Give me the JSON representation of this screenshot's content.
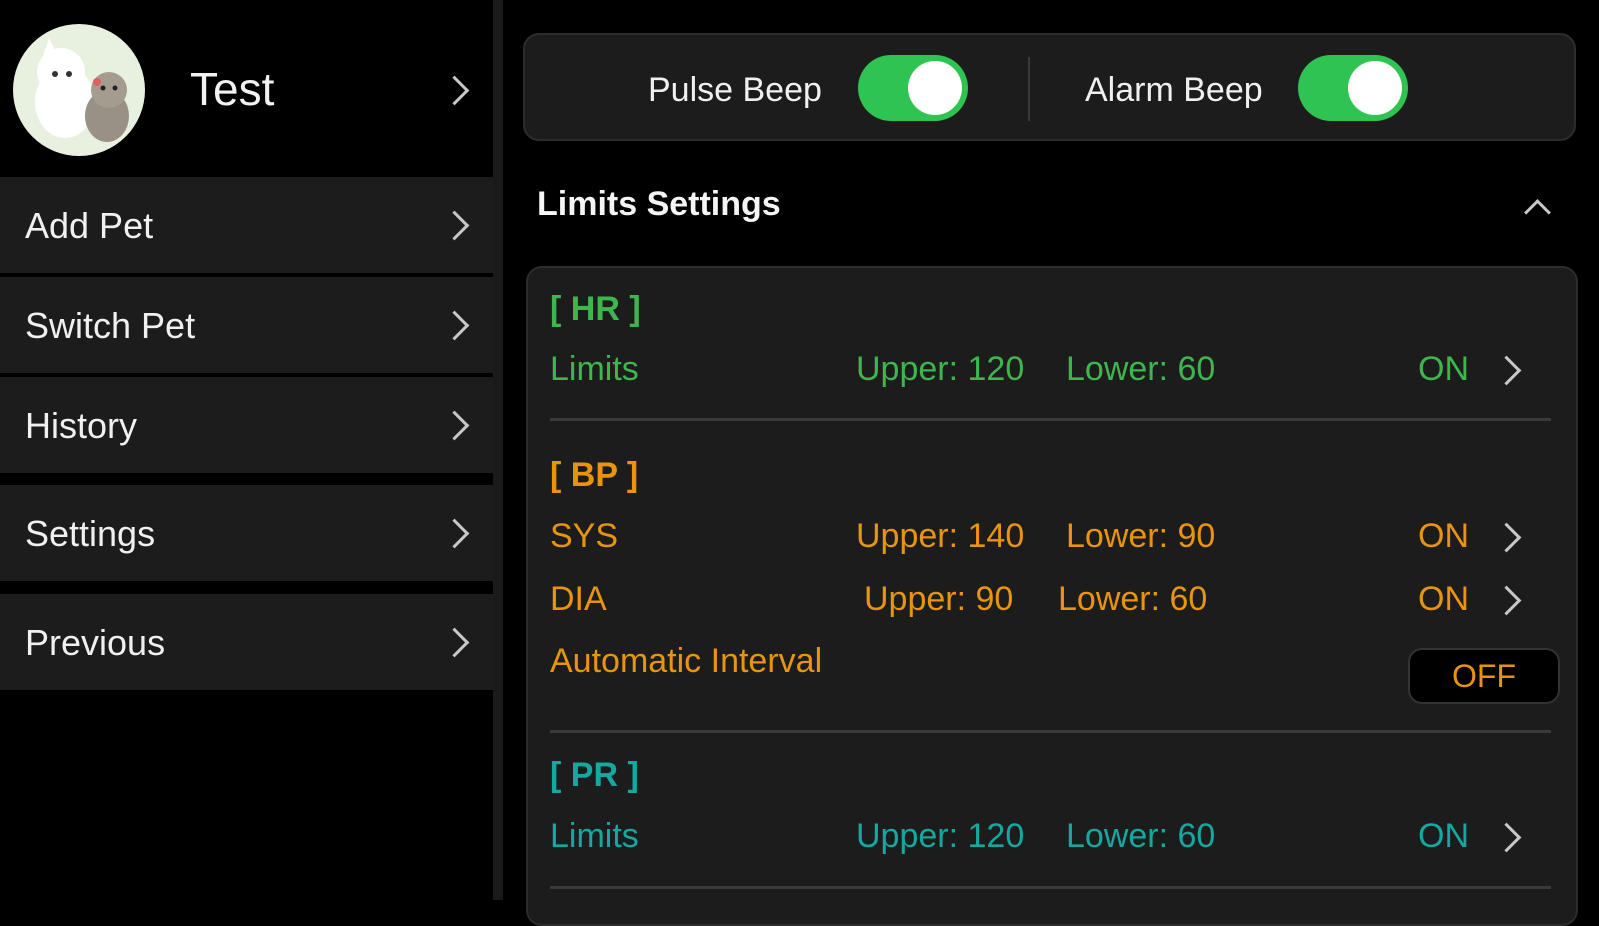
{
  "profile": {
    "name": "Test"
  },
  "menu": {
    "items": [
      {
        "label": "Add Pet"
      },
      {
        "label": "Switch Pet"
      },
      {
        "label": "History"
      },
      {
        "label": "Settings"
      },
      {
        "label": "Previous"
      }
    ]
  },
  "beeps": {
    "pulse": {
      "label": "Pulse Beep",
      "on": true
    },
    "alarm": {
      "label": "Alarm Beep",
      "on": true
    }
  },
  "limits": {
    "title": "Limits Settings",
    "hr": {
      "header": "[ HR ]",
      "row": {
        "label": "Limits",
        "upper": "Upper: 120",
        "lower": "Lower: 60",
        "state": "ON"
      }
    },
    "bp": {
      "header": "[ BP ]",
      "sys": {
        "label": "SYS",
        "upper": "Upper: 140",
        "lower": "Lower: 90",
        "state": "ON"
      },
      "dia": {
        "label": "DIA",
        "upper": "Upper: 90",
        "lower": "Lower: 60",
        "state": "ON"
      },
      "auto_interval": {
        "label": "Automatic Interval",
        "value": "OFF"
      }
    },
    "pr": {
      "header": "[ PR ]",
      "row": {
        "label": "Limits",
        "upper": "Upper: 120",
        "lower": "Lower: 60",
        "state": "ON"
      }
    }
  },
  "colors": {
    "hr": "#3fb54e",
    "bp": "#e8940e",
    "pr": "#15a8a0",
    "toggle_on": "#2fc451"
  }
}
